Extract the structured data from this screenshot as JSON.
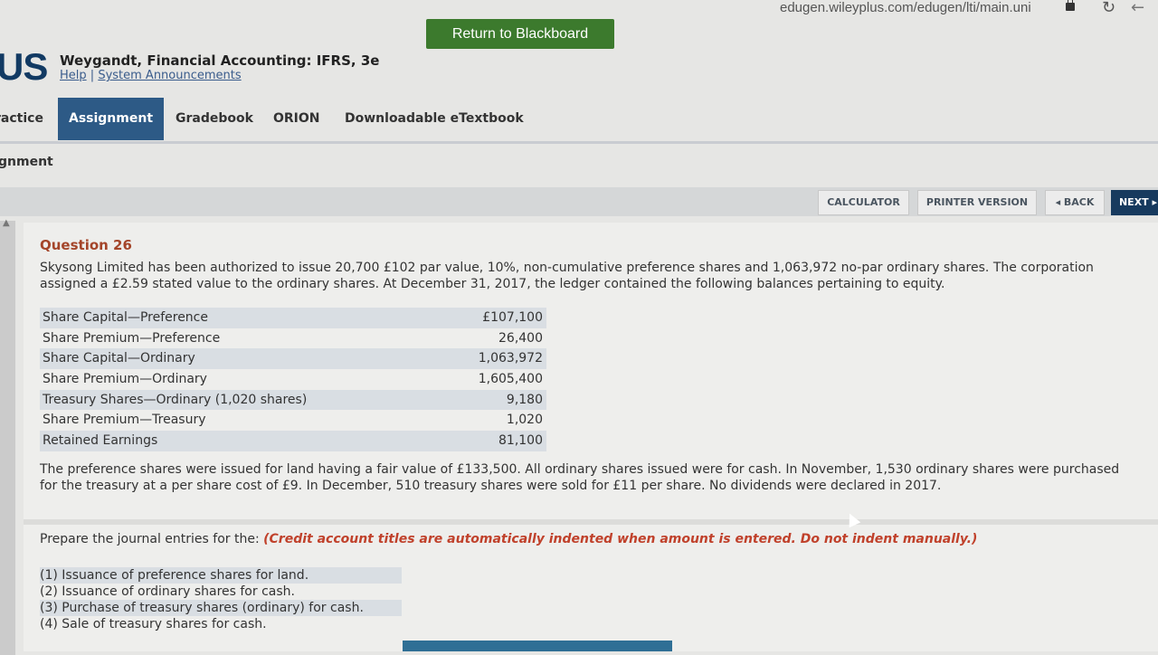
{
  "browser": {
    "url": "edugen.wileyplus.com/edugen/lti/main.uni"
  },
  "header": {
    "return_button": "Return to Blackboard",
    "logo_text": "US",
    "course_title": "Weygandt, Financial Accounting: IFRS, 3e",
    "help": "Help",
    "divider": "|",
    "announcements": "System Announcements"
  },
  "nav": {
    "tabs": [
      "ractice",
      "Assignment",
      "Gradebook",
      "ORION",
      "Downloadable eTextbook"
    ],
    "active": "Assignment"
  },
  "breadcrumb": "gnment",
  "toolbar": {
    "calculator": "CALCULATOR",
    "printer": "PRINTER VERSION",
    "back": "◂ BACK",
    "next": "NEXT ▸"
  },
  "question": {
    "title": "Question 26",
    "intro": "Skysong Limited has been authorized to issue 20,700 £102 par value, 10%, non-cumulative preference shares and 1,063,972 no-par ordinary shares. The corporation assigned a £2.59 stated value to the ordinary shares. At December 31, 2017, the ledger contained the following balances pertaining to equity.",
    "ledger": [
      {
        "label": "Share Capital—Preference",
        "amount": "£107,100"
      },
      {
        "label": "Share Premium—Preference",
        "amount": "26,400"
      },
      {
        "label": "Share Capital—Ordinary",
        "amount": "1,063,972"
      },
      {
        "label": "Share Premium—Ordinary",
        "amount": "1,605,400"
      },
      {
        "label": "Treasury Shares—Ordinary (1,020 shares)",
        "amount": "9,180"
      },
      {
        "label": "Share Premium—Treasury",
        "amount": "1,020"
      },
      {
        "label": "Retained Earnings",
        "amount": "81,100"
      }
    ],
    "details": "The preference shares were issued for land having a fair value of £133,500. All ordinary shares issued were for cash. In November, 1,530 ordinary shares were purchased for the treasury at a per share cost of £9. In December, 510 treasury shares were sold for £11 per share. No dividends were declared in 2017."
  },
  "prepare": {
    "lead": "Prepare the journal entries for the: ",
    "instruction": "(Credit account titles are automatically indented when amount is entered. Do not indent manually.)",
    "items": [
      "(1)  Issuance of preference shares for land.",
      "(2)  Issuance of ordinary shares for cash.",
      "(3)  Purchase of treasury shares (ordinary) for cash.",
      "(4)  Sale of treasury shares for cash."
    ]
  }
}
